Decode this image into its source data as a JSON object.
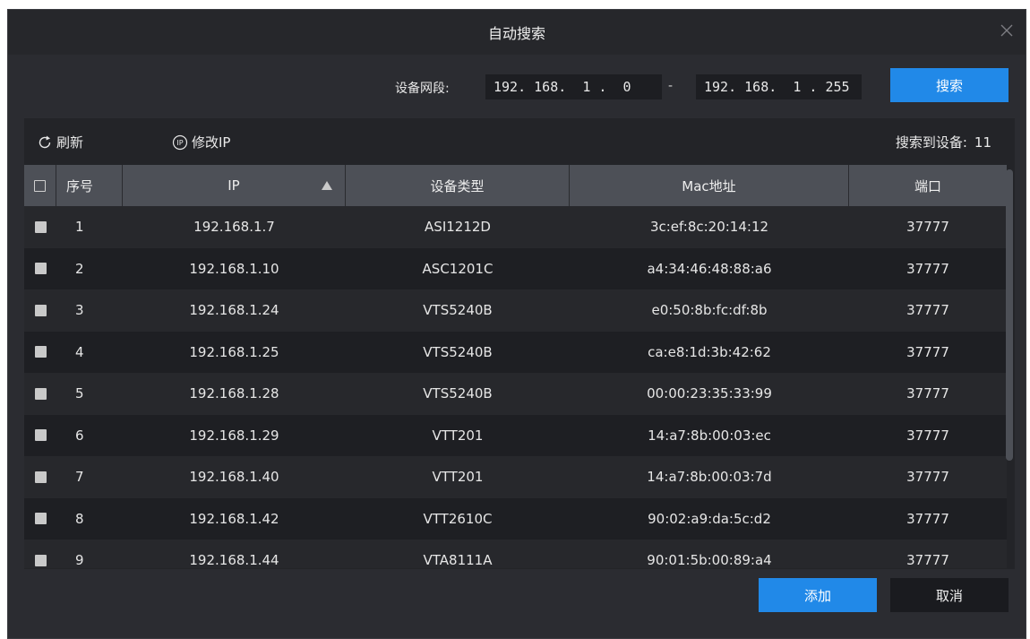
{
  "dialog": {
    "title": "自动搜索",
    "close_icon": "close-icon"
  },
  "segment": {
    "label": "设备网段:",
    "start_ip": "192. 168.  1 .  0",
    "separator": "-",
    "end_ip": "192. 168.  1 . 255",
    "search_label": "搜索"
  },
  "toolbar": {
    "refresh_label": "刷新",
    "refresh_icon": "refresh-icon",
    "modify_ip_label": "修改IP",
    "modify_ip_icon": "ip-icon",
    "found_label": "搜索到设备:",
    "found_count": "11"
  },
  "table": {
    "columns": [
      "序号",
      "IP",
      "设备类型",
      "Mac地址",
      "端口"
    ],
    "sort_column": "IP",
    "sort_direction": "ascending",
    "rows": [
      {
        "idx": "1",
        "ip": "192.168.1.7",
        "type": "ASI1212D",
        "mac": "3c:ef:8c:20:14:12",
        "port": "37777"
      },
      {
        "idx": "2",
        "ip": "192.168.1.10",
        "type": "ASC1201C",
        "mac": "a4:34:46:48:88:a6",
        "port": "37777"
      },
      {
        "idx": "3",
        "ip": "192.168.1.24",
        "type": "VTS5240B",
        "mac": "e0:50:8b:fc:df:8b",
        "port": "37777"
      },
      {
        "idx": "4",
        "ip": "192.168.1.25",
        "type": "VTS5240B",
        "mac": "ca:e8:1d:3b:42:62",
        "port": "37777"
      },
      {
        "idx": "5",
        "ip": "192.168.1.28",
        "type": "VTS5240B",
        "mac": "00:00:23:35:33:99",
        "port": "37777"
      },
      {
        "idx": "6",
        "ip": "192.168.1.29",
        "type": "VTT201",
        "mac": "14:a7:8b:00:03:ec",
        "port": "37777"
      },
      {
        "idx": "7",
        "ip": "192.168.1.40",
        "type": "VTT201",
        "mac": "14:a7:8b:00:03:7d",
        "port": "37777"
      },
      {
        "idx": "8",
        "ip": "192.168.1.42",
        "type": "VTT2610C",
        "mac": "90:02:a9:da:5c:d2",
        "port": "37777"
      },
      {
        "idx": "9",
        "ip": "192.168.1.44",
        "type": "VTA8111A",
        "mac": "90:01:5b:00:89:a4",
        "port": "37777"
      }
    ]
  },
  "footer": {
    "add_label": "添加",
    "cancel_label": "取消"
  },
  "colors": {
    "accent": "#2189e8",
    "background": "#2b2c31",
    "header": "#4d5057"
  }
}
